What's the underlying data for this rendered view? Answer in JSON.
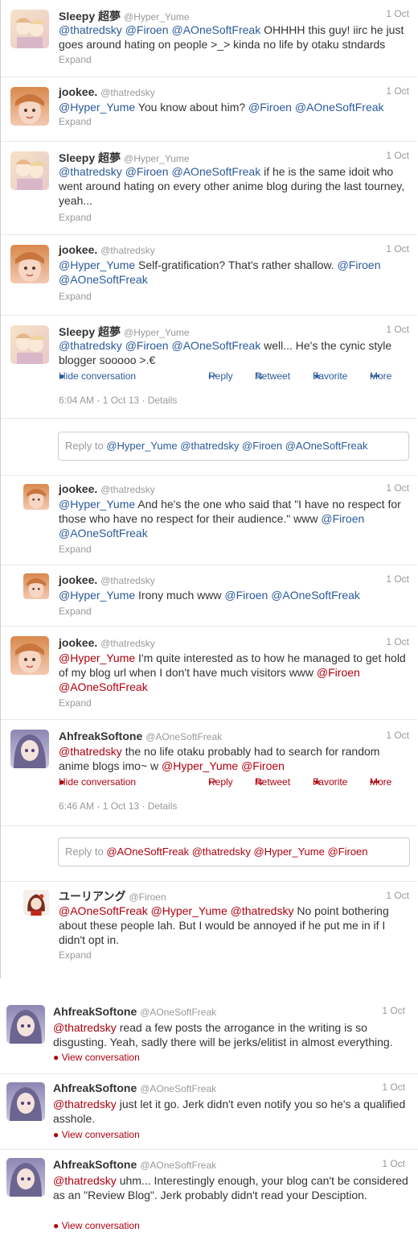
{
  "colors": {
    "mention_blue": "#2a5a9a",
    "mention_red": "#b0000e",
    "muted": "#999999"
  },
  "tweets": [
    {
      "name": "Sleepy 超夢",
      "handle": "@Hyper_Yume",
      "time": "1 Oct",
      "mentions": [
        "@thatredsky",
        "@Firoen",
        "@AOneSoftFreak"
      ],
      "body": " OHHHH this guy! iirc he just goes around hating on people >_> kinda no life by otaku stndards",
      "expand": "Expand"
    },
    {
      "name": "jookee.",
      "handle": "@thatredsky",
      "time": "1 Oct",
      "m1": "@Hyper_Yume",
      "body": " You know about him? ",
      "m2": "@Firoen",
      "m3": "@AOneSoftFreak",
      "expand": "Expand"
    },
    {
      "name": "Sleepy 超夢",
      "handle": "@Hyper_Yume",
      "time": "1 Oct",
      "mentions": [
        "@thatredsky",
        "@Firoen",
        "@AOneSoftFreak"
      ],
      "body": " if he is the same idoit who went around hating on every other anime blog during the last tourney, yeah...",
      "expand": "Expand"
    },
    {
      "name": "jookee.",
      "handle": "@thatredsky",
      "time": "1 Oct",
      "m1": "@Hyper_Yume",
      "body": " Self-gratification? That's rather shallow. ",
      "m2": "@Firoen",
      "m3": "@AOneSoftFreak",
      "expand": "Expand"
    },
    {
      "name": "Sleepy 超夢",
      "handle": "@Hyper_Yume",
      "time": "1 Oct",
      "mentions": [
        "@thatredsky",
        "@Firoen",
        "@AOneSoftFreak"
      ],
      "body": " well... He's the cynic style blogger sooooo >.€",
      "hide": "Hide conversation",
      "reply": "Reply",
      "retweet": "Retweet",
      "favorite": "Favorite",
      "more": "More",
      "meta": "6:04 AM - 1 Oct 13 · Details"
    },
    {
      "reply_label": "Reply to ",
      "reply_mentions": "@Hyper_Yume @thatredsky @Firoen @AOneSoftFreak"
    },
    {
      "name": "jookee.",
      "handle": "@thatredsky",
      "time": "1 Oct",
      "m1": "@Hyper_Yume",
      "body": " And he's the one who said that \"I have no respect for those who have no respect for their audience.\" www ",
      "m2": "@Firoen",
      "m3": "@AOneSoftFreak",
      "expand": "Expand"
    },
    {
      "name": "jookee.",
      "handle": "@thatredsky",
      "time": "1 Oct",
      "m1": "@Hyper_Yume",
      "body": " Irony much www ",
      "m2": "@Firoen",
      "m3": "@AOneSoftFreak",
      "expand": "Expand"
    },
    {
      "name": "jookee.",
      "handle": "@thatredsky",
      "time": "1 Oct",
      "m1": "@Hyper_Yume",
      "body": " I'm quite interested as to how he managed to get hold of my blog url when I don't have much visitors www ",
      "m2": "@Firoen",
      "m3": "@AOneSoftFreak",
      "expand": "Expand"
    },
    {
      "name": "AhfreakSoftone",
      "handle": "@AOneSoftFreak",
      "time": "1 Oct",
      "m1": "@thatredsky",
      "body": " the no life otaku probably had to search for random anime blogs imo~ w ",
      "m2": "@Hyper_Yume",
      "m3": "@Firoen",
      "hide": "Hide conversation",
      "reply": "Reply",
      "retweet": "Retweet",
      "favorite": "Favorite",
      "more": "More",
      "meta": "6:46 AM - 1 Oct 13 · Details"
    },
    {
      "reply_label": "Reply to ",
      "reply_mentions": "@AOneSoftFreak @thatredsky @Hyper_Yume @Firoen"
    },
    {
      "name": "ユーリアング",
      "handle": "@Firoen",
      "time": "1 Oct",
      "m1": "@AOneSoftFreak",
      "m2": "@Hyper_Yume",
      "m3": "@thatredsky",
      "body": " No point bothering about these people lah. But I would be annoyed if he put me in if I didn't opt in.",
      "expand": "Expand"
    },
    {
      "name": "AhfreakSoftone",
      "handle": "@AOneSoftFreak",
      "time": "1 Oct",
      "m1": "@thatredsky",
      "body": " read a few posts the arrogance in the writing is so disgusting. Yeah, sadly there will be jerks/elitist in almost everything.",
      "vc": "View conversation"
    },
    {
      "name": "AhfreakSoftone",
      "handle": "@AOneSoftFreak",
      "time": "1 Oct",
      "m1": "@thatredsky",
      "body": " just let it go. Jerk didn't even notify you so he's a qualified asshole.",
      "vc": "View conversation"
    },
    {
      "name": "AhfreakSoftone",
      "handle": "@AOneSoftFreak",
      "time": "1 Oct",
      "m1": "@thatredsky",
      "body": " uhm... Interestingly enough, your blog can't be considered as an \"Review Blog\". Jerk probably didn't read your Desciption.",
      "vc": "View conversation"
    }
  ]
}
